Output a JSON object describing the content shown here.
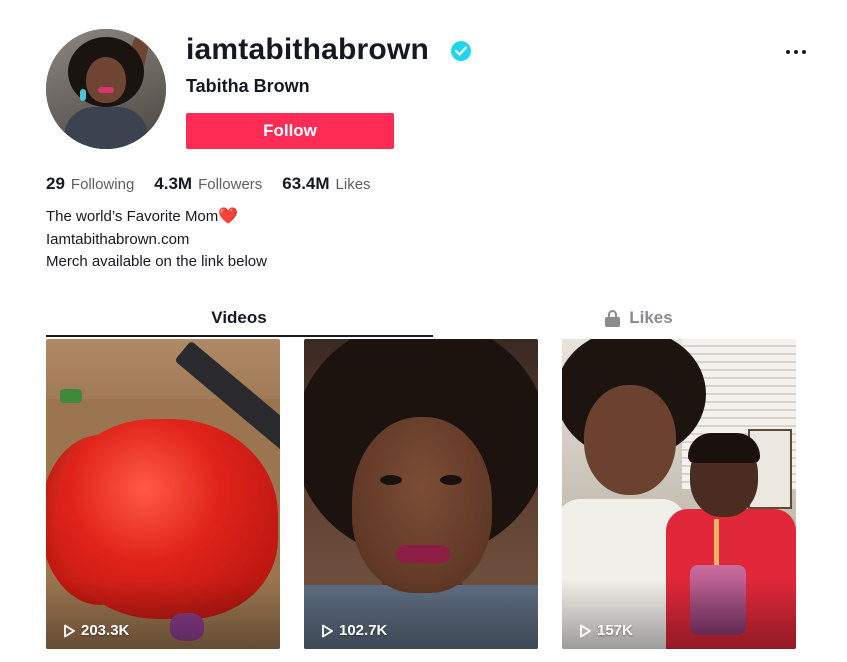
{
  "profile": {
    "username": "iamtabithabrown",
    "display_name": "Tabitha Brown",
    "verified": true,
    "follow_label": "Follow"
  },
  "stats": [
    {
      "value": "29",
      "label": "Following"
    },
    {
      "value": "4.3M",
      "label": "Followers"
    },
    {
      "value": "63.4M",
      "label": "Likes"
    }
  ],
  "bio": {
    "line1": "The world’s Favorite Mom",
    "line1_emoji": "❤️",
    "line2": "Iamtabithabrown.com",
    "line3": "Merch available on the link below"
  },
  "tabs": {
    "videos": "Videos",
    "likes": "Likes"
  },
  "videos": [
    {
      "views": "203.3K"
    },
    {
      "views": "102.7K"
    },
    {
      "views": "157K"
    }
  ],
  "colors": {
    "accent": "#fe2c55",
    "verified": "#20d5ec",
    "text": "#161823",
    "muted": "#5c5e66"
  }
}
